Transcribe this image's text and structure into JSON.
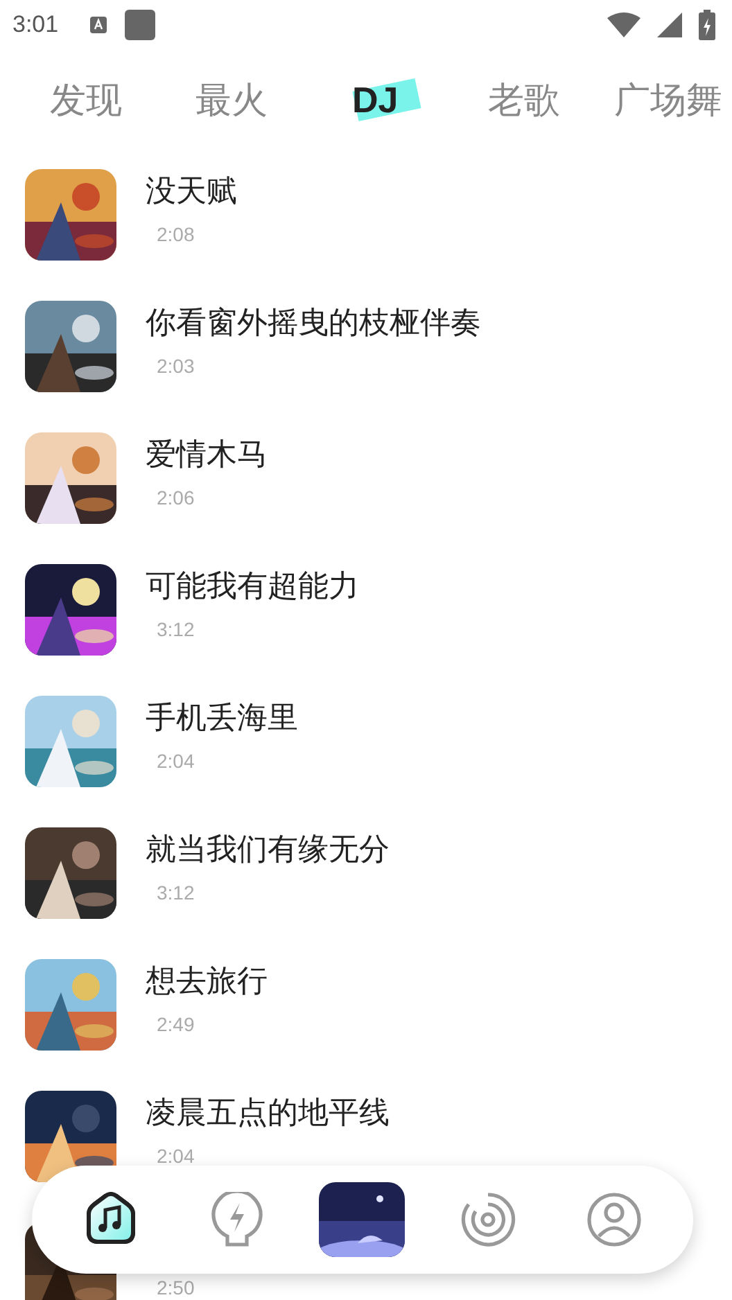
{
  "status_bar": {
    "time": "3:01"
  },
  "tabs": [
    {
      "label": "发现",
      "selected": false
    },
    {
      "label": "最火",
      "selected": false
    },
    {
      "label": "DJ",
      "selected": true
    },
    {
      "label": "老歌",
      "selected": false
    },
    {
      "label": "广场舞",
      "selected": false
    }
  ],
  "songs": [
    {
      "title": "没天赋",
      "duration": "2:08"
    },
    {
      "title": "你看窗外摇曳的枝桠伴奏",
      "duration": "2:03"
    },
    {
      "title": "爱情木马",
      "duration": "2:06"
    },
    {
      "title": "可能我有超能力",
      "duration": "3:12"
    },
    {
      "title": "手机丢海里",
      "duration": "2:04"
    },
    {
      "title": "就当我们有缘无分",
      "duration": "3:12"
    },
    {
      "title": "想去旅行",
      "duration": "2:49"
    },
    {
      "title": "凌晨五点的地平线",
      "duration": "2:04"
    },
    {
      "duration": "2:50"
    }
  ],
  "nav": [
    {
      "kind": "home",
      "selected": true
    },
    {
      "kind": "bolt",
      "selected": false
    },
    {
      "kind": "player"
    },
    {
      "kind": "disc",
      "selected": false
    },
    {
      "kind": "user",
      "selected": false
    }
  ]
}
